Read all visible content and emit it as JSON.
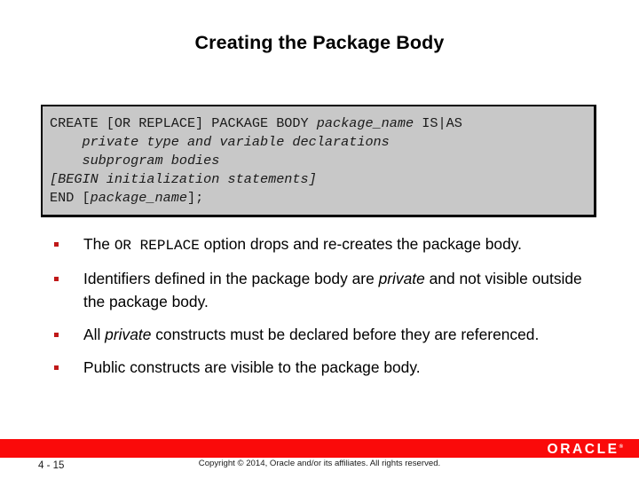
{
  "slide": {
    "title": "Creating the Package Body",
    "code_block": {
      "lines": [
        [
          {
            "text": "CREATE [OR REPLACE] PACKAGE BODY ",
            "style": "normal"
          },
          {
            "text": "package_name",
            "style": "italic"
          },
          {
            "text": " IS|AS",
            "style": "normal"
          }
        ],
        [
          {
            "text": "    private type and variable declarations",
            "style": "italic"
          }
        ],
        [
          {
            "text": "    subprogram bodies",
            "style": "italic"
          }
        ],
        [
          {
            "text": "[BEGIN initialization statements]",
            "style": "italic"
          }
        ],
        [
          {
            "text": "END [",
            "style": "normal"
          },
          {
            "text": "package_name",
            "style": "italic"
          },
          {
            "text": "];",
            "style": "normal"
          }
        ]
      ],
      "plain_text": "CREATE [OR REPLACE] PACKAGE BODY package_name IS|AS\n    private type and variable declarations\n    subprogram bodies\n[BEGIN initialization statements]\nEND [package_name];",
      "background_color": "#c8c8c8",
      "border_color": "#000000"
    },
    "bullets": [
      {
        "marker": "square-bullet",
        "runs": [
          {
            "text": "The ",
            "style": "normal"
          },
          {
            "text": "OR REPLACE",
            "style": "mono"
          },
          {
            "text": " option drops and re-creates the package body.",
            "style": "normal"
          }
        ],
        "plain_text": "The OR REPLACE option drops and re-creates the package body."
      },
      {
        "marker": "square-bullet",
        "runs": [
          {
            "text": "Identifiers defined in the package body are ",
            "style": "normal"
          },
          {
            "text": "private",
            "style": "italic"
          },
          {
            "text": " and not visible outside the package body.",
            "style": "normal"
          }
        ],
        "plain_text": "Identifiers defined in the package body are private and not visible outside the package body."
      },
      {
        "marker": "square-bullet",
        "runs": [
          {
            "text": "All ",
            "style": "normal"
          },
          {
            "text": "private",
            "style": "italic"
          },
          {
            "text": " constructs must be declared before they are referenced.",
            "style": "normal"
          }
        ],
        "plain_text": "All private constructs must be declared before they are referenced."
      },
      {
        "marker": "square-bullet",
        "runs": [
          {
            "text": "Public constructs are visible to the package body.",
            "style": "normal"
          }
        ],
        "plain_text": "Public constructs are visible to the package body."
      }
    ],
    "footer": {
      "page_number": "4 - 15",
      "copyright": "Copyright © 2014, Oracle and/or its affiliates. All rights reserved.",
      "logo_text": "ORACLE",
      "logo_tm": "®",
      "bar_color": "#fa0a0a",
      "bullet_color": "#c01818"
    }
  }
}
